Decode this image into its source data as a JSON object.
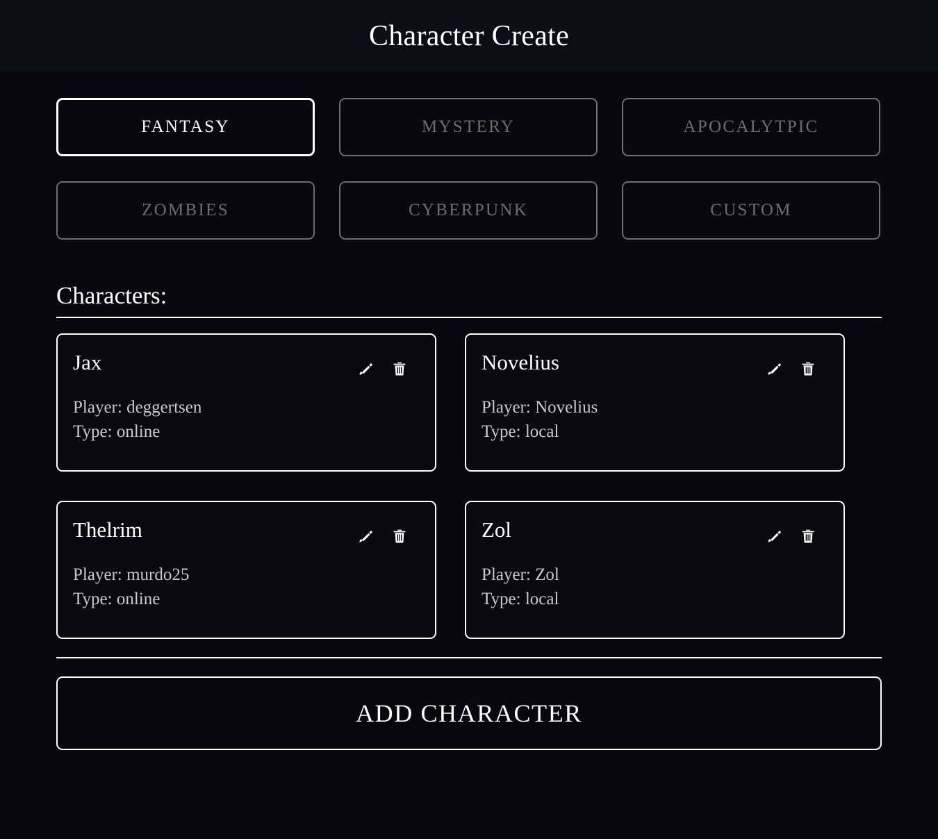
{
  "header": {
    "title": "Character Create"
  },
  "genres": {
    "items": [
      {
        "label": "FANTASY",
        "active": true
      },
      {
        "label": "MYSTERY",
        "active": false
      },
      {
        "label": "APOCALYTPIC",
        "active": false
      },
      {
        "label": "ZOMBIES",
        "active": false
      },
      {
        "label": "CYBERPUNK",
        "active": false
      },
      {
        "label": "CUSTOM",
        "active": false
      }
    ]
  },
  "characters_section": {
    "heading": "Characters:",
    "player_label": "Player:",
    "type_label": "Type:",
    "edit_icon": "pencil-icon",
    "delete_icon": "trash-icon",
    "cards": [
      {
        "name": "Jax",
        "player_line": "Player: deggertsen",
        "type_line": "Type: online",
        "player": "deggertsen",
        "type": "online"
      },
      {
        "name": "Novelius",
        "player_line": "Player: Novelius",
        "type_line": "Type: local",
        "player": "Novelius",
        "type": "local"
      },
      {
        "name": "Thelrim",
        "player_line": "Player: murdo25",
        "type_line": "Type: online",
        "player": "murdo25",
        "type": "online"
      },
      {
        "name": "Zol",
        "player_line": "Player: Zol",
        "type_line": "Type: local",
        "player": "Zol",
        "type": "local"
      }
    ]
  },
  "footer": {
    "add_character_label": "ADD CHARACTER"
  },
  "colors": {
    "header_background": "#0a0e17",
    "page_background": "#0a0711",
    "accent_active": "#ffffff",
    "border_inactive": "#6e6e6e",
    "text_inactive": "#6d6d6d",
    "text_meta": "#c9c9cd"
  }
}
